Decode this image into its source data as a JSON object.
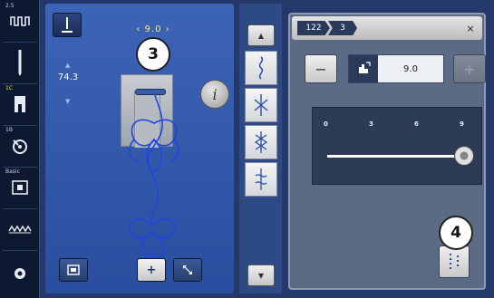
{
  "left_sidebar": {
    "items": [
      {
        "tag": "2.5",
        "icon": "stitch-length-icon"
      },
      {
        "tag": "",
        "icon": "needle-icon"
      },
      {
        "tag": "1C",
        "icon": "presser-foot-icon"
      },
      {
        "tag": "1B",
        "icon": "bobbin-icon"
      },
      {
        "tag": "Basic",
        "icon": "stitch-plate-icon"
      },
      {
        "tag": "",
        "icon": "feed-dog-icon"
      },
      {
        "tag": "",
        "icon": "settings-gear-icon"
      }
    ]
  },
  "stitch_area": {
    "top_value": "9.0",
    "side_value": "74.3",
    "info_label": "i"
  },
  "callouts": {
    "three": "3",
    "four": "4"
  },
  "stitch_list": {
    "up_label": "▲",
    "down_label": "▼"
  },
  "panel": {
    "crumb_stitch_number": "122",
    "crumb_level": "3",
    "close_label": "×",
    "minus_label": "−",
    "plus_label": "+",
    "value": "9.0",
    "slider_ticks": [
      "0",
      "3",
      "6",
      "9"
    ],
    "slider_value": 9,
    "slider_max": 9
  },
  "colors": {
    "background": "#24396a",
    "stitch_blue": "#2046e0",
    "value_yellow": "#ffe070"
  }
}
